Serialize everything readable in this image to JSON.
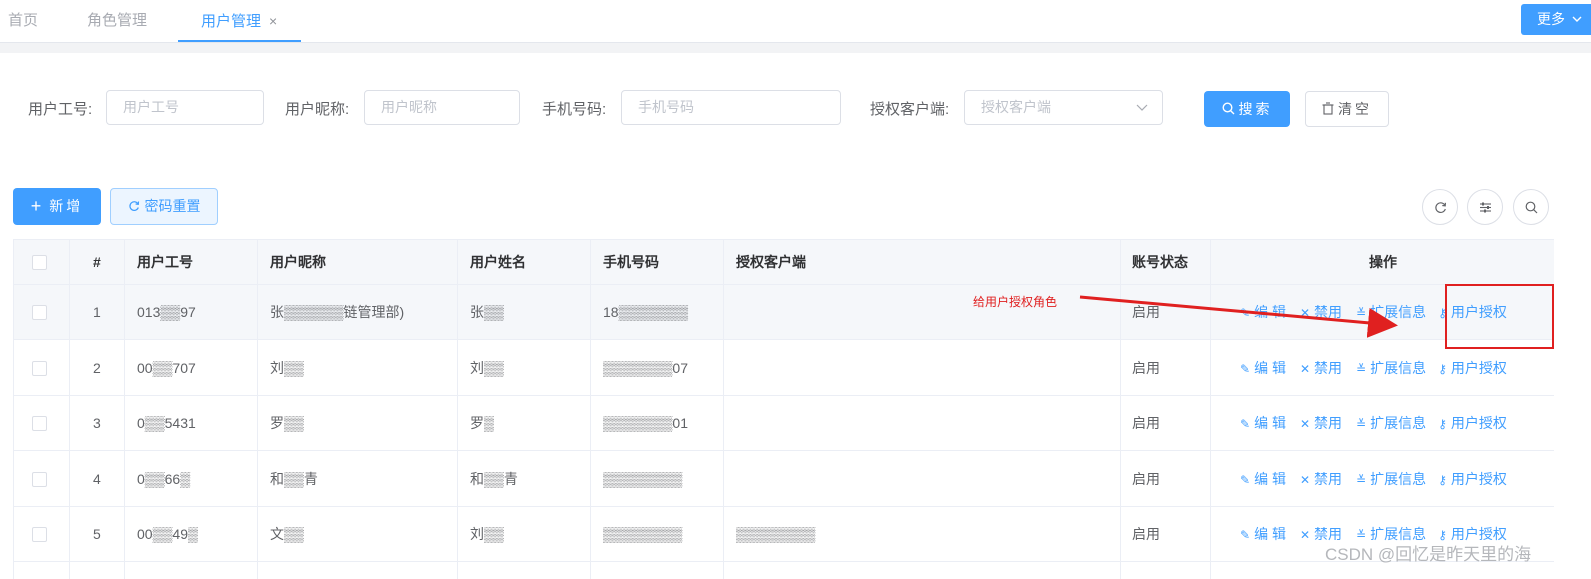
{
  "tabs": [
    {
      "label": "首页",
      "active": false
    },
    {
      "label": "角色管理",
      "active": false
    },
    {
      "label": "用户管理",
      "active": true,
      "closable": true
    }
  ],
  "tab_close_icon": "×",
  "more_button": {
    "label": "更多",
    "icon": "chevron-down-icon"
  },
  "search_form": {
    "user_no": {
      "label": "用户工号:",
      "placeholder": "用户工号"
    },
    "nickname": {
      "label": "用户昵称:",
      "placeholder": "用户昵称"
    },
    "phone": {
      "label": "手机号码:",
      "placeholder": "手机号码"
    },
    "client": {
      "label": "授权客户端:",
      "placeholder": "授权客户端"
    },
    "search_label": "搜索",
    "clear_label": "清空"
  },
  "toolbar": {
    "add_label": "新增",
    "reset_password_label": "密码重置",
    "icons": [
      "refresh-icon",
      "columns-settings-icon",
      "search-toggle-icon"
    ]
  },
  "table": {
    "headers": [
      "#",
      "用户工号",
      "用户昵称",
      "用户姓名",
      "手机号码",
      "授权客户端",
      "账号状态",
      "操作"
    ],
    "action_labels": {
      "edit": "编 辑",
      "disable": "禁用",
      "ext_info": "扩展信息",
      "authorize": "用户授权"
    },
    "rows": [
      {
        "index": "1",
        "user_no": "013▒▒97",
        "nickname": "张▒▒▒▒▒▒链管理部)",
        "realname": "张▒▒",
        "phone": "18▒▒▒▒▒▒▒",
        "client": "",
        "status": "启用"
      },
      {
        "index": "2",
        "user_no": "00▒▒707",
        "nickname": "刘▒▒",
        "realname": "刘▒▒",
        "phone": "▒▒▒▒▒▒▒07",
        "client": "",
        "status": "启用"
      },
      {
        "index": "3",
        "user_no": "0▒▒5431",
        "nickname": "罗▒▒",
        "realname": "罗▒",
        "phone": "▒▒▒▒▒▒▒01",
        "client": "",
        "status": "启用"
      },
      {
        "index": "4",
        "user_no": "0▒▒66▒",
        "nickname": "和▒▒青",
        "realname": "和▒▒青",
        "phone": "▒▒▒▒▒▒▒▒",
        "client": "",
        "status": "启用"
      },
      {
        "index": "5",
        "user_no": "00▒▒49▒",
        "nickname": "文▒▒",
        "realname": "刘▒▒",
        "phone": "▒▒▒▒▒▒▒▒",
        "client": "▒▒▒▒▒▒▒▒",
        "status": "启用"
      }
    ]
  },
  "annotation": {
    "text": "给用户授权角色",
    "color": "#e02020"
  },
  "watermark": "CSDN @回忆是昨天里的海",
  "colors": {
    "primary": "#409eff",
    "annotation": "#e02020"
  }
}
